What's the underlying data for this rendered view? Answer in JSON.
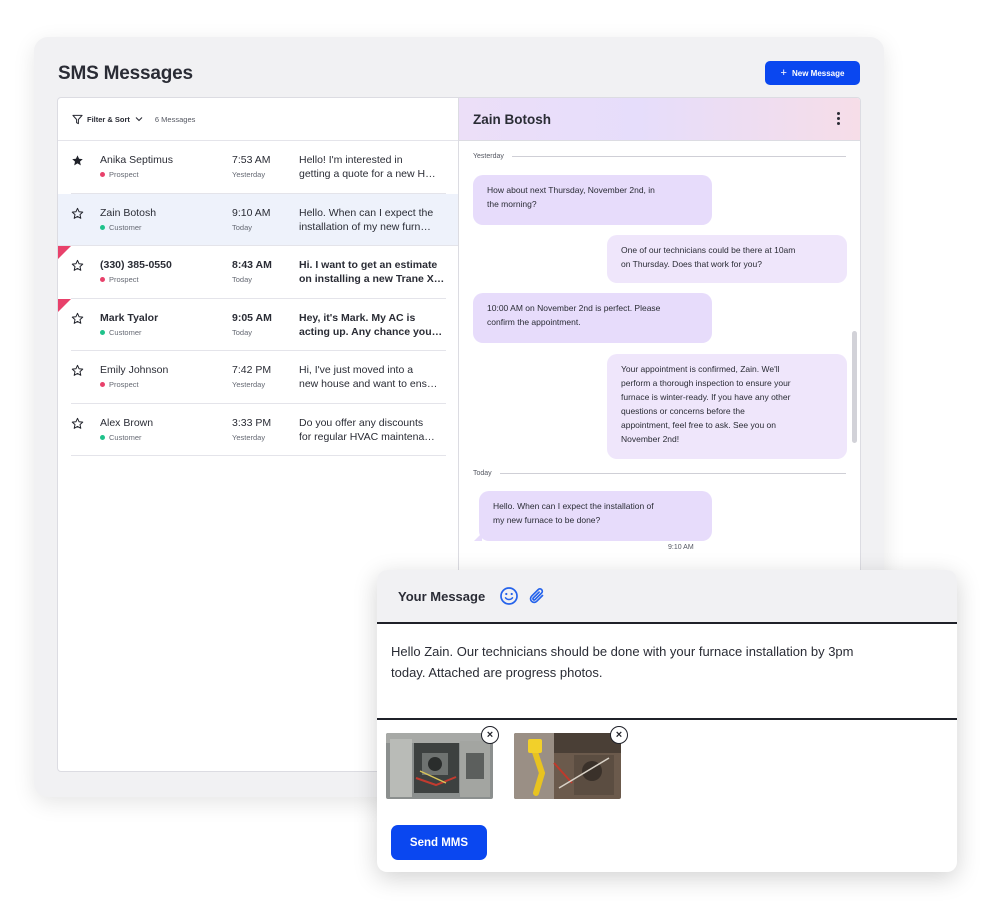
{
  "app": {
    "title": "SMS Messages",
    "new_message_label": "New Message",
    "accent": "#0a47f0"
  },
  "list": {
    "filter_label": "Filter & Sort",
    "count_label": "6 Messages",
    "conversations": [
      {
        "name": "Anika Septimus",
        "tag": "Prospect",
        "tag_color": "#e8416b",
        "time": "7:53 AM",
        "day": "Yesterday",
        "preview_1": "Hello! I'm interested in",
        "preview_2": "getting a quote for a new H…",
        "starred": true,
        "unread": false,
        "flagged": false,
        "selected": false
      },
      {
        "name": "Zain Botosh",
        "tag": "Customer",
        "tag_color": "#1fc28b",
        "time": "9:10 AM",
        "day": "Today",
        "preview_1": "Hello. When can I expect the",
        "preview_2": "installation of my new furn…",
        "starred": false,
        "unread": false,
        "flagged": false,
        "selected": true
      },
      {
        "name": "(330) 385-0550",
        "tag": "Prospect",
        "tag_color": "#e8416b",
        "time": "8:43 AM",
        "day": "Today",
        "preview_1": "Hi. I want to get an estimate",
        "preview_2": "on installing a new Trane X…",
        "starred": false,
        "unread": true,
        "flagged": true,
        "selected": false
      },
      {
        "name": "Mark Tyalor",
        "tag": "Customer",
        "tag_color": "#1fc28b",
        "time": "9:05 AM",
        "day": "Today",
        "preview_1": "Hey, it's Mark. My AC is",
        "preview_2": "acting up. Any chance you…",
        "starred": false,
        "unread": true,
        "flagged": true,
        "selected": false
      },
      {
        "name": "Emily Johnson",
        "tag": "Prospect",
        "tag_color": "#e8416b",
        "time": "7:42 PM",
        "day": "Yesterday",
        "preview_1": "Hi, I've just moved into a",
        "preview_2": "new house and want to ens…",
        "starred": false,
        "unread": false,
        "flagged": false,
        "selected": false
      },
      {
        "name": "Alex Brown",
        "tag": "Customer",
        "tag_color": "#1fc28b",
        "time": "3:33 PM",
        "day": "Yesterday",
        "preview_1": "Do you offer any discounts",
        "preview_2": "for regular HVAC maintena…",
        "starred": false,
        "unread": false,
        "flagged": false,
        "selected": false
      }
    ]
  },
  "chat": {
    "contact_name": "Zain Botosh",
    "divider_yesterday": "Yesterday",
    "divider_today": "Today",
    "messages": [
      {
        "lines": [
          "How about next Thursday, November 2nd, in",
          "the morning?"
        ]
      },
      {
        "lines": [
          "One of our technicians could be there at 10am",
          "on Thursday.  Does that work for you?"
        ]
      },
      {
        "lines": [
          "10:00 AM on November 2nd is perfect. Please",
          "confirm the appointment."
        ]
      },
      {
        "lines": [
          "Your appointment is confirmed, Zain. We'll",
          "perform a thorough inspection to ensure your",
          "furnace is winter-ready.  If you have any other",
          "questions or concerns before the",
          "appointment, feel free to ask. See you on",
          "November 2nd!"
        ]
      },
      {
        "lines": [
          "Hello. When can I expect the installation of",
          "my new furnace to be done?"
        ],
        "time": "9:10 AM"
      }
    ]
  },
  "compose": {
    "title": "Your Message",
    "text_line_1": "Hello Zain. Our technicians should be done with your furnace installation by 3pm",
    "text_line_2": "today. Attached are progress photos.",
    "remove_glyph": "×",
    "send_label": "Send MMS"
  }
}
